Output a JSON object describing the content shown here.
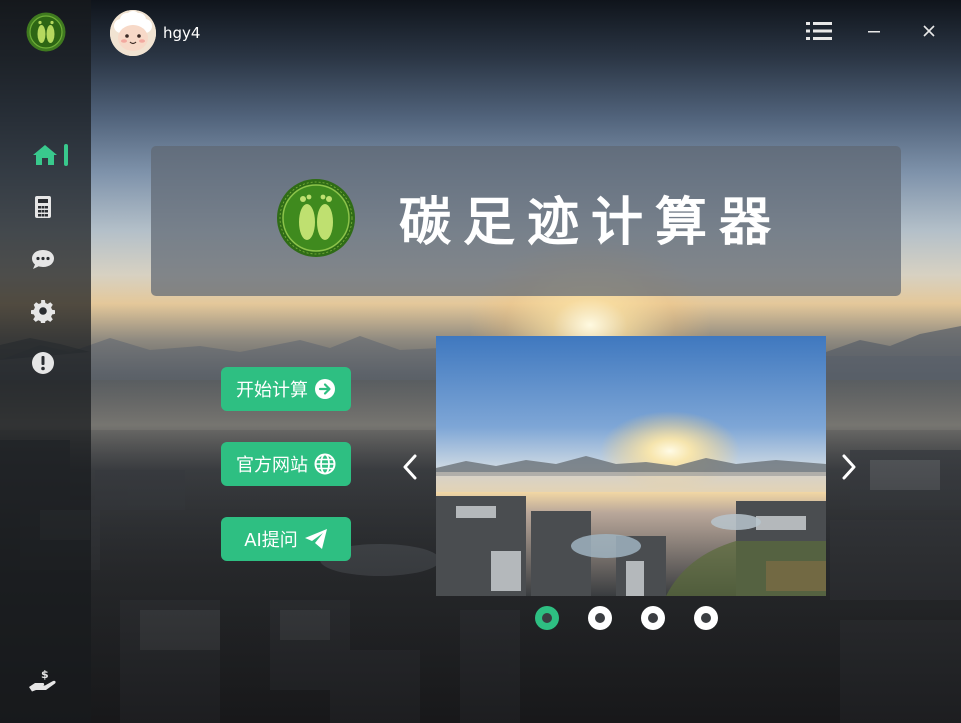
{
  "user": {
    "name": "hgy4"
  },
  "app": {
    "title": "碳足迹计算器"
  },
  "nav": {
    "items": [
      "home-icon",
      "calculator-icon",
      "chat-icon",
      "settings-icon",
      "info-icon"
    ],
    "active": "home-icon",
    "footer_icon": "donate-icon"
  },
  "actions": {
    "start": "开始计算",
    "website": "官方网站",
    "ai": "AI提问"
  },
  "carousel": {
    "slide_count": 4,
    "active_index": 0
  },
  "colors": {
    "accent": "#2ebf82",
    "sidebar": "#181a1d",
    "banner": "#5f6873"
  }
}
